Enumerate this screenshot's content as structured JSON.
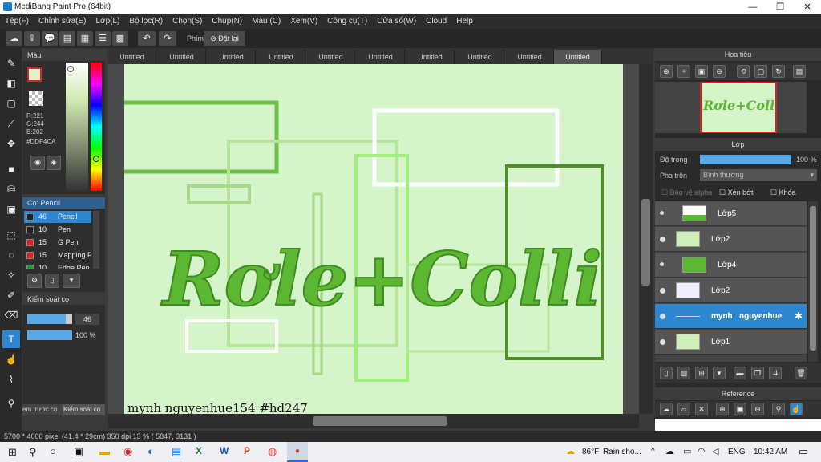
{
  "app": {
    "title": "MediBang Paint Pro (64bit)"
  },
  "window_controls": {
    "minimize": "—",
    "maximize": "❐",
    "close": "✕"
  },
  "menu": [
    "Tệp(F)",
    "Chỉnh sửa(E)",
    "Lớp(L)",
    "Bộ lọc(R)",
    "Chọn(S)",
    "Chụp(N)",
    "Màu (C)",
    "Xem(V)",
    "Công cụ(T)",
    "Cửa sổ(W)",
    "Cloud",
    "Help"
  ],
  "toolbar": {
    "shortcut_label": "Phím",
    "reset_label": "Đặt lại"
  },
  "tabs": [
    "Untitled",
    "Untitled",
    "Untitled",
    "Untitled",
    "Untitled",
    "Untitled",
    "Untitled",
    "Untitled",
    "Untitled",
    "Untitled"
  ],
  "color_panel": {
    "title": "Màu",
    "r": "R:221",
    "g": "G:244",
    "b": "B:202",
    "hex": "#DDF4CA",
    "current_color": "#DDF4CA"
  },
  "brush_panel": {
    "title": "Cọ: Pencil",
    "items": [
      {
        "size": "46",
        "name": "Pencil",
        "color": "#222222"
      },
      {
        "size": "10",
        "name": "Pen",
        "color": "#222222"
      },
      {
        "size": "15",
        "name": "G Pen",
        "color": "#e02020"
      },
      {
        "size": "15",
        "name": "Mapping Pen",
        "color": "#e02020"
      },
      {
        "size": "10",
        "name": "Edge Pen",
        "color": "#20a020"
      }
    ]
  },
  "control_panel": {
    "title": "Kiểm soát cọ",
    "size_value": "46",
    "opacity_value": "100 %",
    "size_fraction": 0.85,
    "opacity_fraction": 1.0,
    "tab1": "em trước cọ",
    "tab2": "Kiểm soát cọ"
  },
  "canvas": {
    "art_text": "Rơle+Colli",
    "watermark": "mynh   nguyenhue154   #hd247",
    "bg": "#D6F4CA"
  },
  "navigator": {
    "title": "Hoa tiêu",
    "thumb_text": "Rơle+Colli"
  },
  "layer_panel": {
    "title": "Lớp",
    "opacity_label": "Độ trong",
    "opacity_value": "100 %",
    "blend_label": "Pha trộn",
    "blend_value": "Bình thường",
    "protect_alpha": "Bảo vệ alpha",
    "clipping": "Xén bớt",
    "lock": "Khóa",
    "layers": [
      {
        "name": "Lớp5"
      },
      {
        "name": "Lớp2"
      },
      {
        "name": "Lớp4"
      },
      {
        "name": "Lớp2"
      },
      {
        "name": "mynh   nguyenhue"
      },
      {
        "name": "Lớp1"
      }
    ]
  },
  "reference_panel": {
    "title": "Reference"
  },
  "status": {
    "text": "5700 * 4000 pixel   (41.4 * 29cm)   350 dpi   13 %   ( 5847, 3131 )"
  },
  "taskbar": {
    "weather_temp": "86°F",
    "weather_text": "Rain sho...",
    "lang": "ENG",
    "time": "10:42 AM"
  }
}
